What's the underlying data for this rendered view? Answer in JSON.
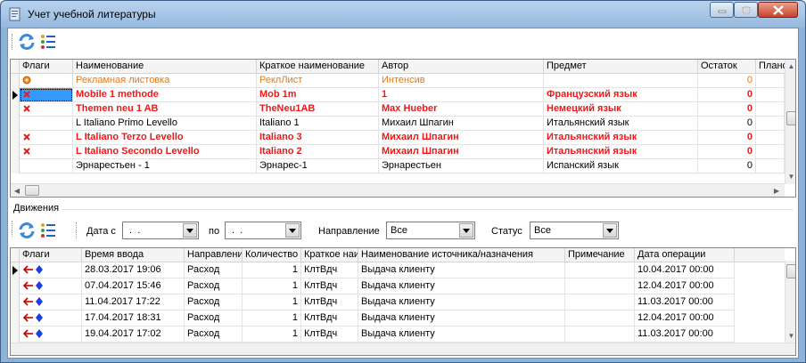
{
  "window": {
    "title": "Учет учебной литературы"
  },
  "books": {
    "columns": [
      "Флаги",
      "Наименование",
      "Краткое наименование",
      "Автор",
      "Предмет",
      "Остаток",
      "Плано"
    ],
    "rows": [
      {
        "flag": "circle",
        "name": "Рекламная листовка",
        "short": "РеклЛист",
        "author": "Интенсив",
        "subject": "",
        "rest": "0",
        "style": "orange"
      },
      {
        "flag": "x",
        "name": "Mobile  1 methode",
        "short": "Mob 1m",
        "author": "1",
        "subject": "Французский язык",
        "rest": "0",
        "style": "red",
        "selected": true
      },
      {
        "flag": "x",
        "name": "Themen neu 1 AB",
        "short": "TheNeu1AB",
        "author": "Max Hueber",
        "subject": "Немецкий язык",
        "rest": "0",
        "style": "red"
      },
      {
        "flag": "",
        "name": "L Italiano Primo Levello",
        "short": "Italiano 1",
        "author": "Михаил Шпагин",
        "subject": "Итальянский язык",
        "rest": "0",
        "style": "normal"
      },
      {
        "flag": "x",
        "name": "L Italiano Terzo Levello",
        "short": "Italiano 3",
        "author": "Михаил Шпагин",
        "subject": "Итальянский язык",
        "rest": "0",
        "style": "red"
      },
      {
        "flag": "x",
        "name": "L Italiano Secondo Levello",
        "short": "Italiano 2",
        "author": "Михаил Шпагин",
        "subject": "Итальянский язык",
        "rest": "0",
        "style": "red"
      },
      {
        "flag": "",
        "name": "Эрнарестьен - 1",
        "short": "Эрнарес-1",
        "author": "Эрнарестьен",
        "subject": "Испанский язык",
        "rest": "0",
        "style": "normal"
      }
    ]
  },
  "movements": {
    "section_label": "Движения",
    "date_from_label": "Дата с",
    "date_from_value": " .  .",
    "date_to_label": "по",
    "date_to_value": " .  .",
    "direction_label": "Направление",
    "direction_value": "Все",
    "status_label": "Статус",
    "status_value": "Все",
    "columns": [
      "Флаги",
      "Время ввода",
      "Направлени",
      "Количество",
      "Краткое наи",
      "Наименование источника/назначения",
      "Примечание",
      "Дата операции"
    ],
    "rows": [
      {
        "time": "28.03.2017 19:06",
        "direction": "Расход",
        "qty": "1",
        "short": "КлтВдч",
        "source": "Выдача клиенту",
        "note": "",
        "op_date": "10.04.2017 00:00"
      },
      {
        "time": "07.04.2017 15:46",
        "direction": "Расход",
        "qty": "1",
        "short": "КлтВдч",
        "source": "Выдача клиенту",
        "note": "",
        "op_date": "12.04.2017 00:00"
      },
      {
        "time": "11.04.2017 17:22",
        "direction": "Расход",
        "qty": "1",
        "short": "КлтВдч",
        "source": "Выдача клиенту",
        "note": "",
        "op_date": "11.03.2017 00:00"
      },
      {
        "time": "17.04.2017 18:31",
        "direction": "Расход",
        "qty": "1",
        "short": "КлтВдч",
        "source": "Выдача клиенту",
        "note": "",
        "op_date": "12.04.2017 00:00"
      },
      {
        "time": "19.04.2017 17:02",
        "direction": "Расход",
        "qty": "1",
        "short": "КлтВдч",
        "source": "Выдача клиенту",
        "note": "",
        "op_date": "11.03.2017 00:00"
      }
    ]
  },
  "colors": {
    "red_text": "#e81b1b",
    "orange_text": "#e87818",
    "selection": "#3399ff",
    "arrow_red": "#c00000",
    "diamond_blue": "#1a3fe0"
  }
}
